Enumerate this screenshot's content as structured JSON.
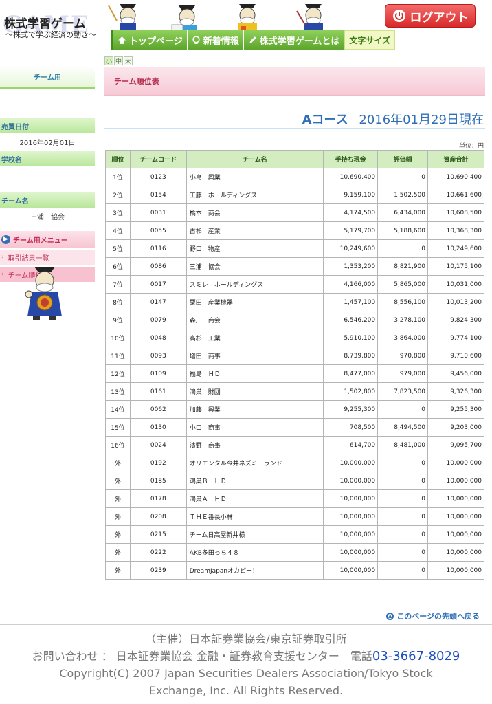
{
  "header": {
    "logo_bg": "GAME",
    "logo_title": "株式学習ゲーム",
    "logo_sub": "〜株式で学ぶ経済の動き〜",
    "logout_label": "ログアウト",
    "nav": [
      {
        "label": "トップページ",
        "icon": "home-icon"
      },
      {
        "label": "新着情報",
        "icon": "bulb-icon"
      },
      {
        "label": "株式学習ゲームとは",
        "icon": "pencil-icon"
      }
    ],
    "font_size_label": "文字サイズ"
  },
  "font_toggles": [
    "小",
    "中",
    "大"
  ],
  "sidebar": {
    "heading": "チーム用",
    "trade_date_label": "売買日付",
    "trade_date_value": "2016年02月01日",
    "school_label": "学校名",
    "school_value": "",
    "team_label": "チーム名",
    "team_value": "三浦　協会",
    "menu_heading": "チーム用メニュー",
    "menu_items": [
      "取引結果一覧",
      "チーム順位表"
    ]
  },
  "main": {
    "page_title": "チーム順位表",
    "course": "Aコース",
    "as_of": "2016年01月29日現在",
    "unit": "単位：円",
    "columns": [
      "順位",
      "チームコード",
      "チーム名",
      "手持ち現金",
      "評価額",
      "資産合計"
    ],
    "rows": [
      [
        "1位",
        "0123",
        "小島　興業",
        "10,690,400",
        "0",
        "10,690,400"
      ],
      [
        "2位",
        "0154",
        "工藤　ホールディングス",
        "9,159,100",
        "1,502,500",
        "10,661,600"
      ],
      [
        "3位",
        "0031",
        "橋本　商会",
        "4,174,500",
        "6,434,000",
        "10,608,500"
      ],
      [
        "4位",
        "0055",
        "古杉　産業",
        "5,179,700",
        "5,188,600",
        "10,368,300"
      ],
      [
        "5位",
        "0116",
        "野口　物産",
        "10,249,600",
        "0",
        "10,249,600"
      ],
      [
        "6位",
        "0086",
        "三浦　協会",
        "1,353,200",
        "8,821,900",
        "10,175,100"
      ],
      [
        "7位",
        "0017",
        "スミレ　ホールディングス",
        "4,166,000",
        "5,865,000",
        "10,031,000"
      ],
      [
        "8位",
        "0147",
        "栗田　産業機器",
        "1,457,100",
        "8,556,100",
        "10,013,200"
      ],
      [
        "9位",
        "0079",
        "森川　商会",
        "6,546,200",
        "3,278,100",
        "9,824,300"
      ],
      [
        "10位",
        "0048",
        "高杉　工業",
        "5,910,100",
        "3,864,000",
        "9,774,100"
      ],
      [
        "11位",
        "0093",
        "増田　商事",
        "8,739,800",
        "970,800",
        "9,710,600"
      ],
      [
        "12位",
        "0109",
        "福島　ＨＤ",
        "8,477,000",
        "979,000",
        "9,456,000"
      ],
      [
        "13位",
        "0161",
        "鴻巣　財団",
        "1,502,800",
        "7,823,500",
        "9,326,300"
      ],
      [
        "14位",
        "0062",
        "加藤　興業",
        "9,255,300",
        "0",
        "9,255,300"
      ],
      [
        "15位",
        "0130",
        "小口　商事",
        "708,500",
        "8,494,500",
        "9,203,000"
      ],
      [
        "16位",
        "0024",
        "濱野　商事",
        "614,700",
        "8,481,000",
        "9,095,700"
      ],
      [
        "外",
        "0192",
        "オリエンタル今井ネズミーランド",
        "10,000,000",
        "0",
        "10,000,000"
      ],
      [
        "外",
        "0185",
        "鴻巣Ｂ　ＨＤ",
        "10,000,000",
        "0",
        "10,000,000"
      ],
      [
        "外",
        "0178",
        "鴻巣Ａ　ＨＤ",
        "10,000,000",
        "0",
        "10,000,000"
      ],
      [
        "外",
        "0208",
        "ＴＨＥ番長小林",
        "10,000,000",
        "0",
        "10,000,000"
      ],
      [
        "外",
        "0215",
        "チーム日高屋新井様",
        "10,000,000",
        "0",
        "10,000,000"
      ],
      [
        "外",
        "0222",
        "AKB多田っち４８",
        "10,000,000",
        "0",
        "10,000,000"
      ],
      [
        "外",
        "0239",
        "DreamJapanオカピー！",
        "10,000,000",
        "0",
        "10,000,000"
      ]
    ],
    "back_to_top": "このページの先頭へ戻る"
  },
  "footer": {
    "organizer": "（主催）日本証券業協会/東京証券取引所",
    "contact": "お問い合わせ ： 日本証券業協会 金融・証券教育支援センター　電話",
    "tel": "03-3667-8029",
    "copyright_1": "Copyright(C) 2007 Japan Securities Dealers Association/Tokyo Stock",
    "copyright_2": "Exchange, Inc. All Rights Reserved."
  },
  "colors": {
    "accent_green": "#5da52c",
    "accent_pink": "#c42a55",
    "link_blue": "#2f6fb7",
    "logout_red": "#d92a2a"
  }
}
